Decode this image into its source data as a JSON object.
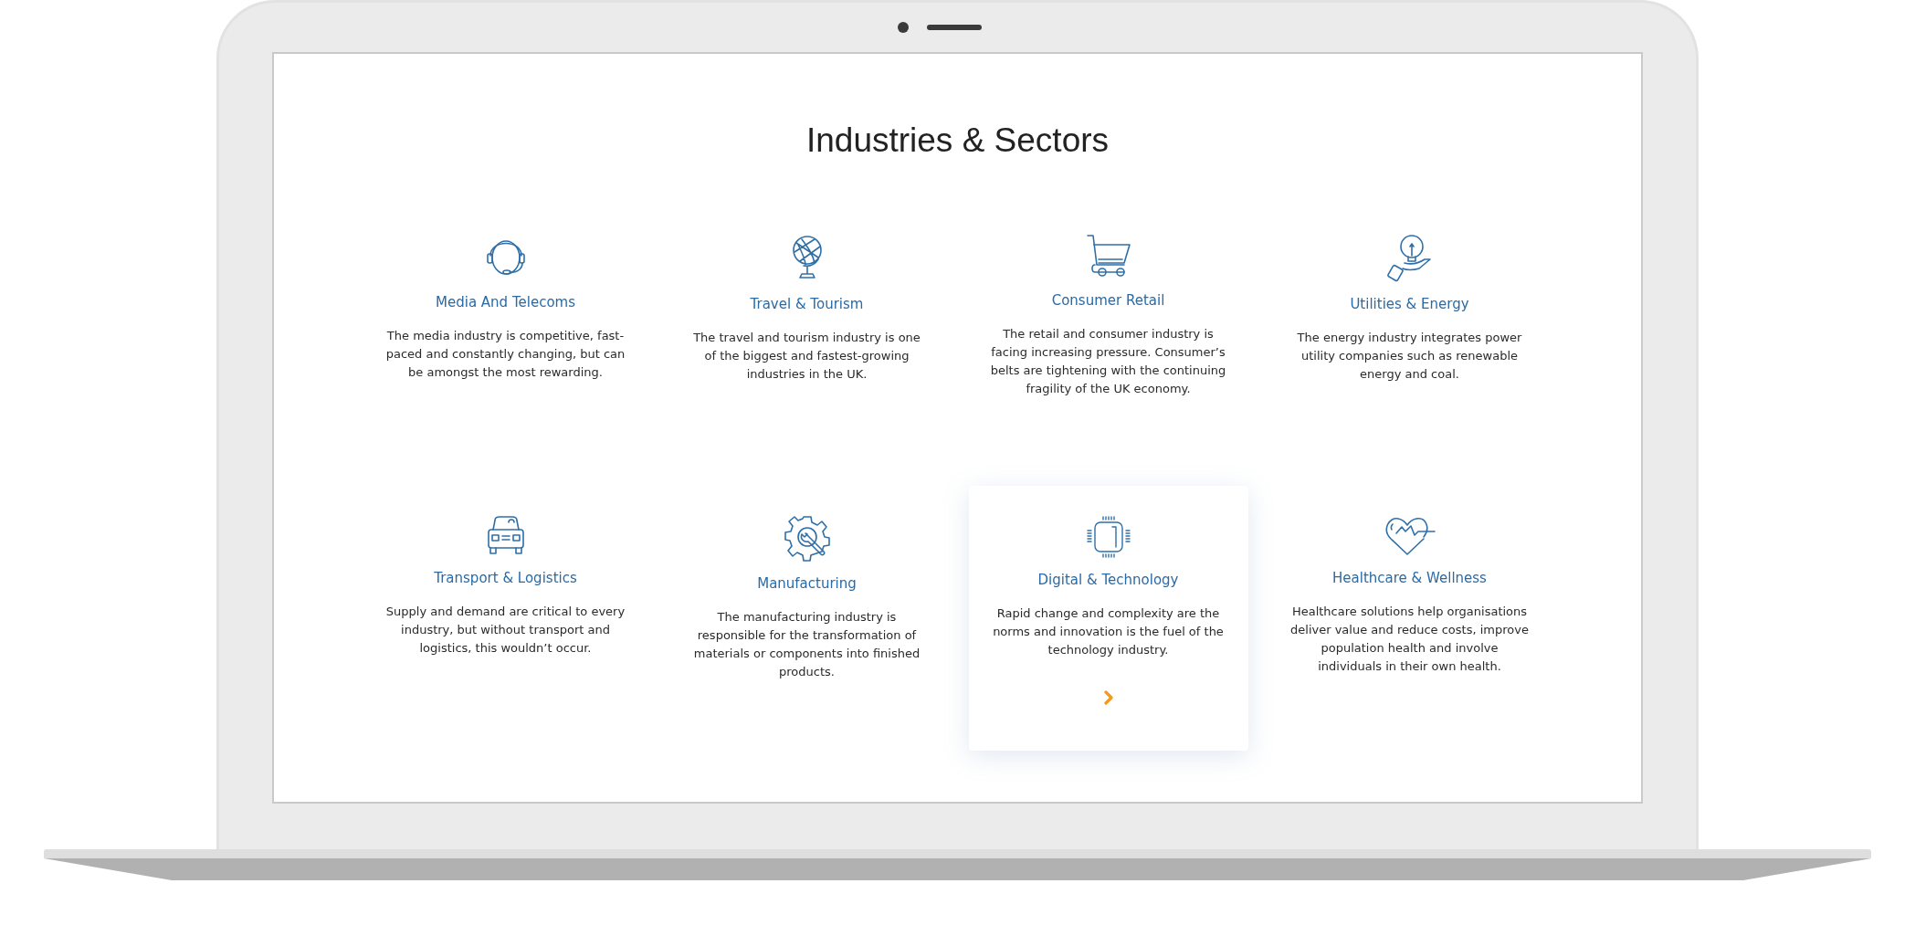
{
  "title": "Industries & Sectors",
  "sectors": [
    {
      "name": "Media And Telecoms",
      "description": "The media industry is competitive, fast-paced and constantly changing, but can be amongst the most rewarding.",
      "selected": false
    },
    {
      "name": "Travel & Tourism",
      "description": "The travel and tourism industry is one of the biggest and fastest-growing industries in the UK.",
      "selected": false
    },
    {
      "name": "Consumer Retail",
      "description": "The retail and consumer industry is facing increasing pressure. Consumer’s belts are tightening with the continuing fragility of the UK economy.",
      "selected": false
    },
    {
      "name": "Utilities & Energy",
      "description": "The energy industry integrates power utility companies such as renewable energy and coal.",
      "selected": false
    },
    {
      "name": "Transport & Logistics",
      "description": "Supply and demand are critical to every industry, but without transport and logistics, this wouldn’t occur.",
      "selected": false
    },
    {
      "name": "Manufacturing",
      "description": "The manufacturing industry is responsible for the transformation of materials or components into finished products.",
      "selected": false
    },
    {
      "name": "Digital & Technology",
      "description": "Rapid change and complexity are the norms and innovation is the fuel of the technology industry.",
      "selected": true
    },
    {
      "name": "Healthcare & Wellness",
      "description": "Healthcare solutions help organisations deliver value and reduce costs, improve population health and involve individuals in their own health.",
      "selected": false
    }
  ]
}
